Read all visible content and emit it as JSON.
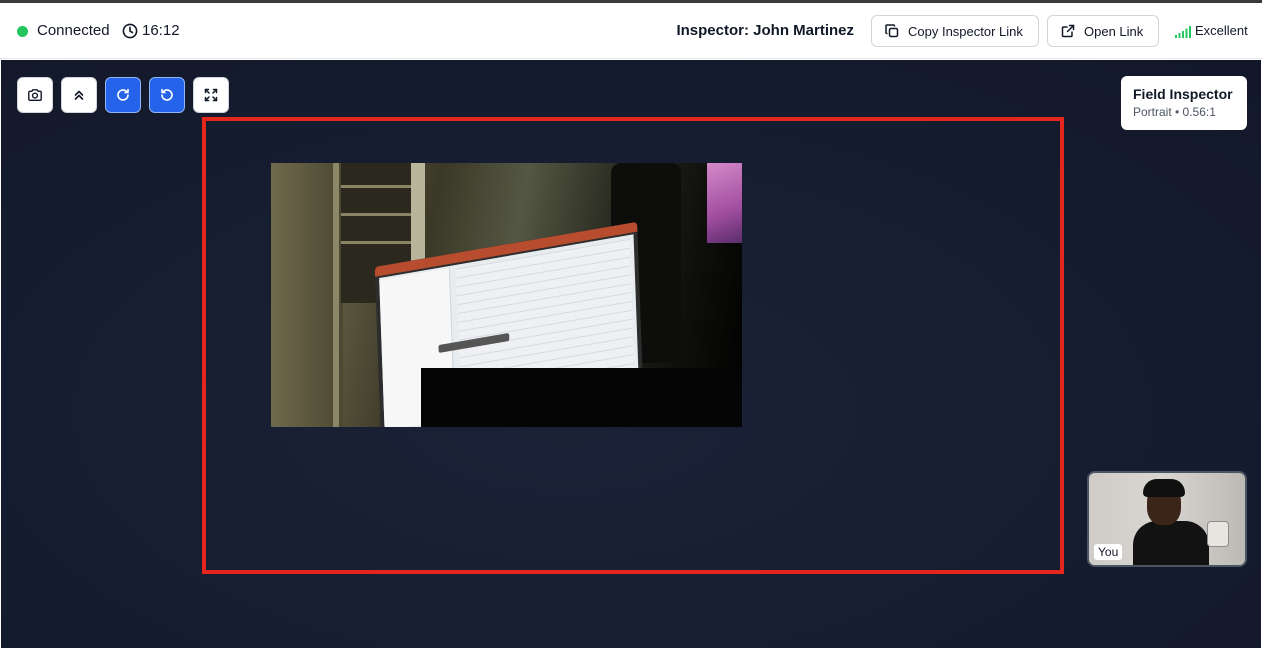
{
  "header": {
    "connection_status": "Connected",
    "status_color": "#22c55e",
    "timer": "16:12",
    "inspector_label": "Inspector: John Martinez",
    "copy_link_label": "Copy Inspector Link",
    "open_link_label": "Open Link",
    "quality_label": "Excellent",
    "quality_color": "#22c55e"
  },
  "toolbar": {
    "buttons": [
      {
        "name": "camera-icon",
        "style": "white"
      },
      {
        "name": "chevrons-up-icon",
        "style": "white"
      },
      {
        "name": "rotate-cw-icon",
        "style": "blue"
      },
      {
        "name": "rotate-ccw-icon",
        "style": "blue"
      },
      {
        "name": "fullscreen-icon",
        "style": "white"
      }
    ]
  },
  "field_card": {
    "title": "Field Inspector",
    "subtitle": "Portrait • 0.56:1"
  },
  "self_view": {
    "label": "You"
  },
  "colors": {
    "accent_blue": "#2563eb",
    "focus_frame": "#e5261d",
    "stage_background": "#161d30"
  }
}
